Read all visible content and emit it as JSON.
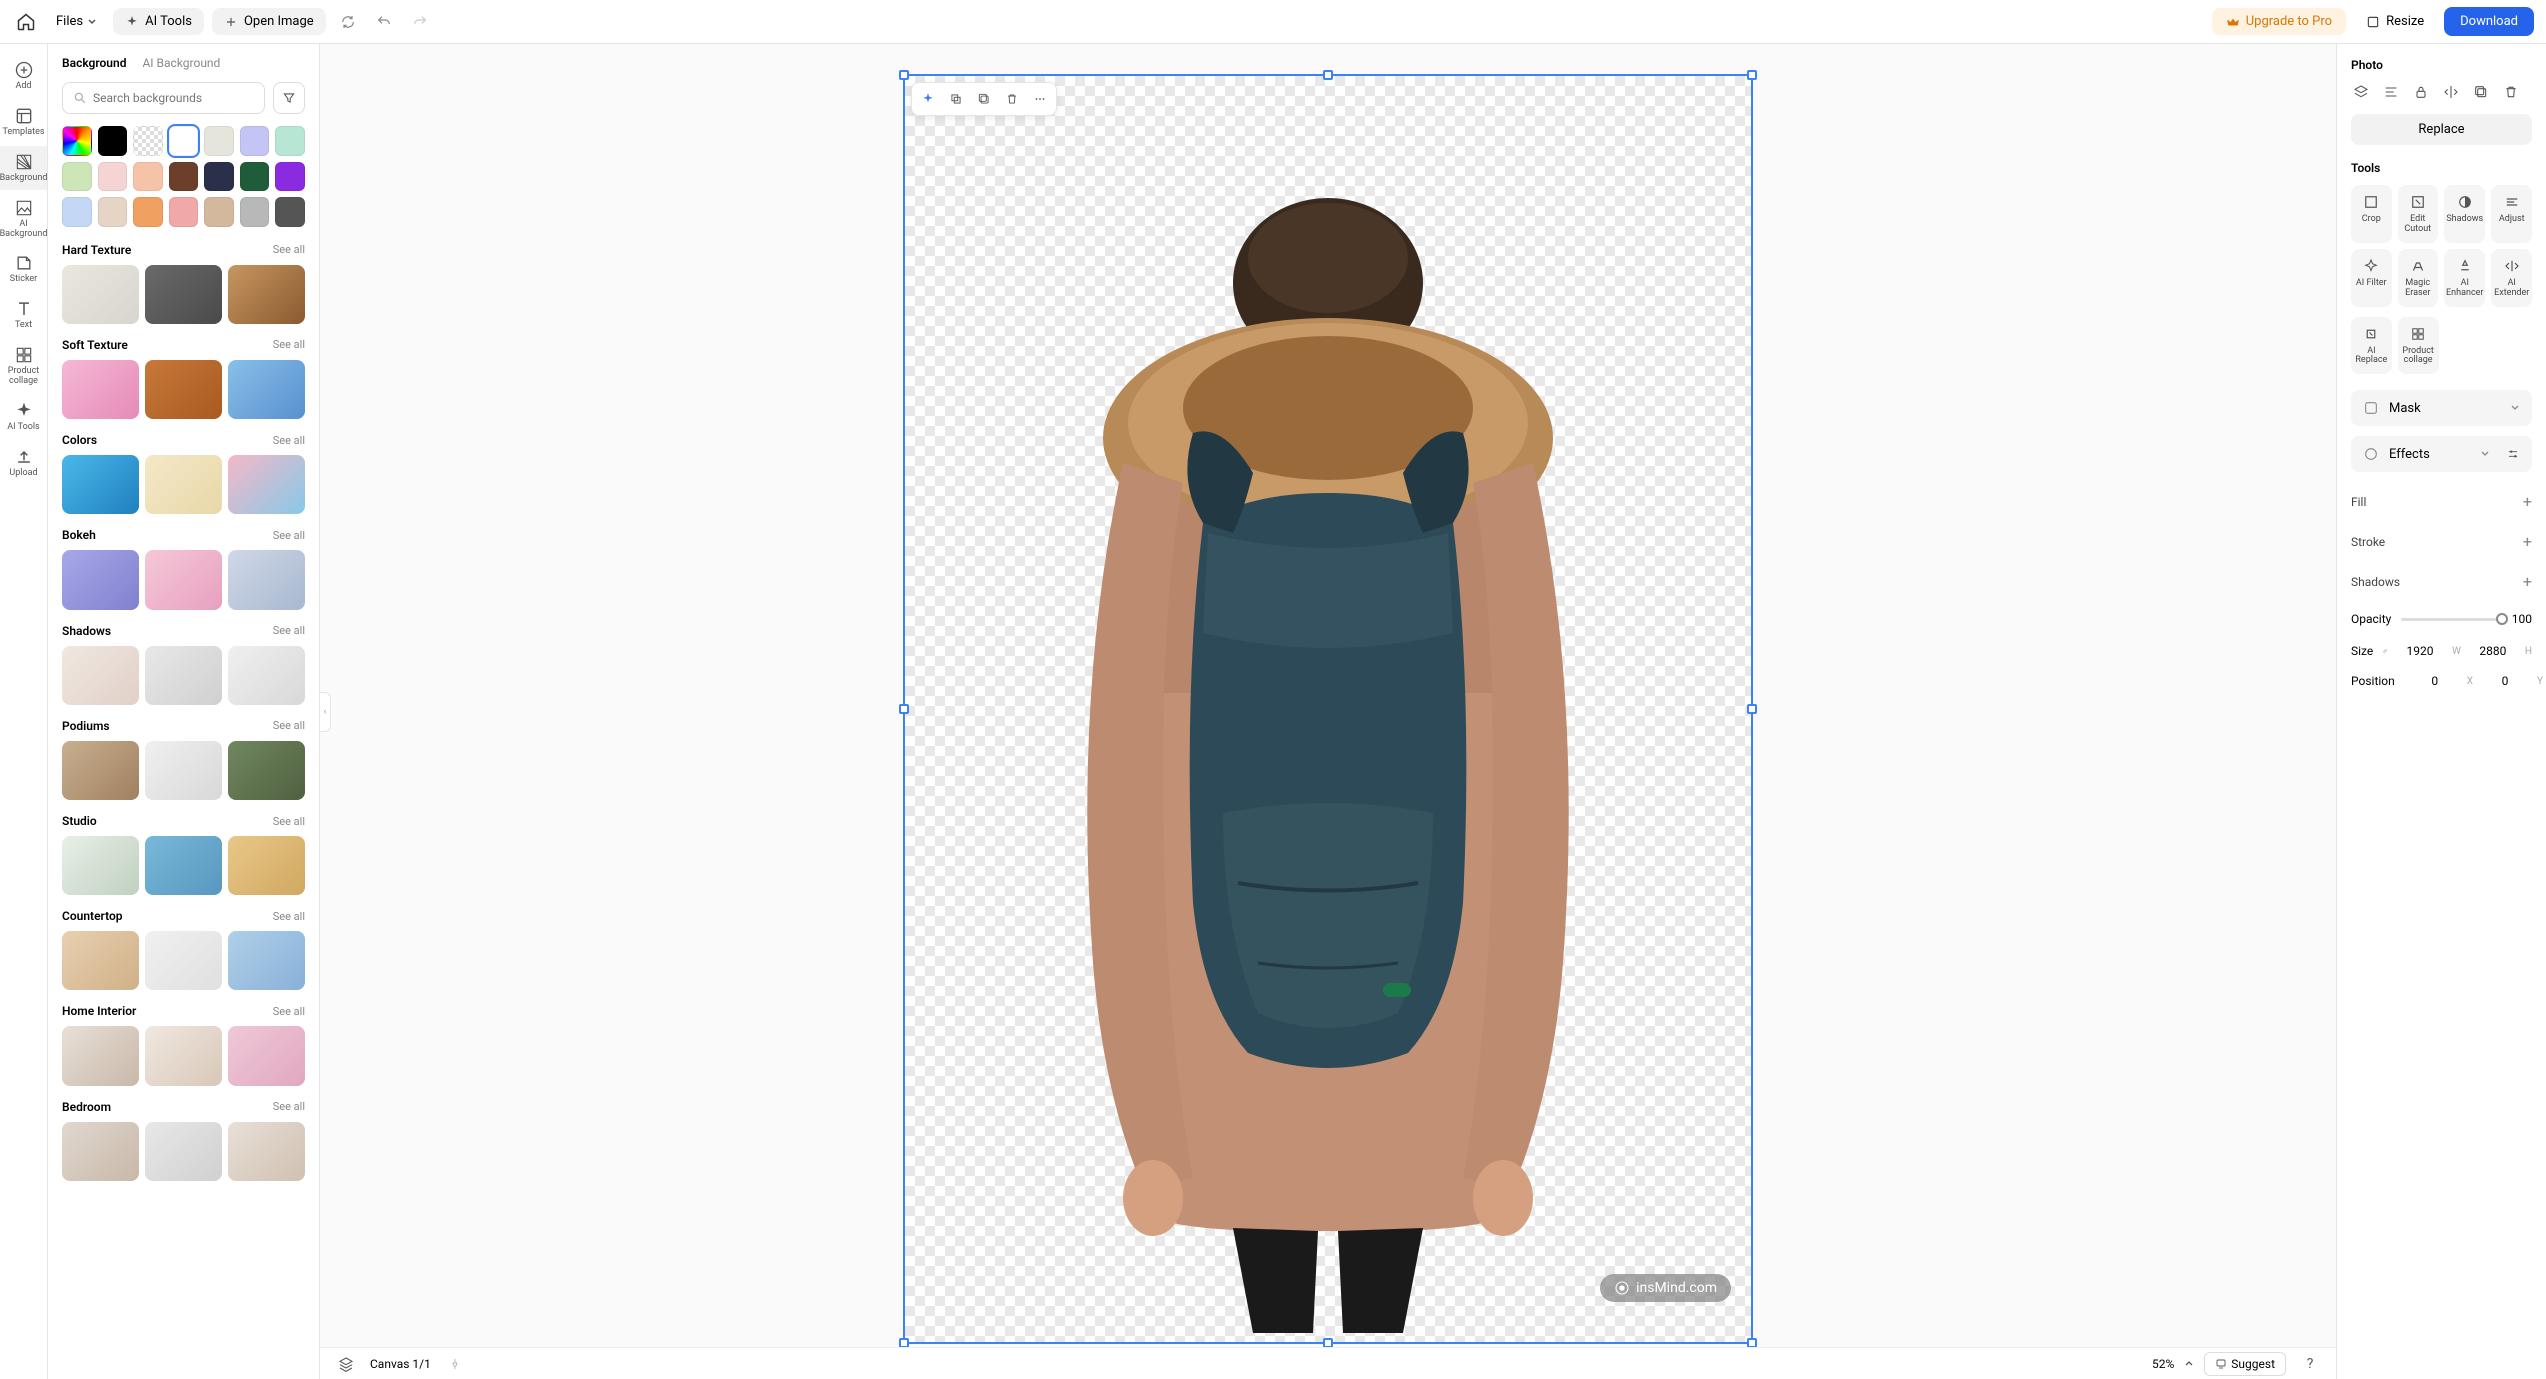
{
  "topbar": {
    "files": "Files",
    "ai_tools": "AI Tools",
    "open_image": "Open Image",
    "upgrade": "Upgrade to Pro",
    "resize": "Resize",
    "download": "Download"
  },
  "vrail": {
    "items": [
      {
        "label": "Add",
        "icon": "plus-circle"
      },
      {
        "label": "Templates",
        "icon": "template"
      },
      {
        "label": "Background",
        "icon": "background",
        "active": true
      },
      {
        "label": "AI Background",
        "icon": "ai-bg"
      },
      {
        "label": "Sticker",
        "icon": "sticker"
      },
      {
        "label": "Text",
        "icon": "text"
      },
      {
        "label": "Product collage",
        "icon": "collage"
      },
      {
        "label": "AI Tools",
        "icon": "ai-tools"
      },
      {
        "label": "Upload",
        "icon": "upload"
      }
    ]
  },
  "leftPanel": {
    "tabs": {
      "background": "Background",
      "ai_background": "AI Background"
    },
    "search_placeholder": "Search backgrounds",
    "swatches": [
      "rainbow",
      "#000000",
      "transparent",
      "#ffffff",
      "#e5e5dc",
      "#c4c4f5",
      "#b8e6d4",
      "#cde6b8",
      "#f5d4d4",
      "#f5c4a8",
      "#6b3f2a",
      "#2a2f4a",
      "#1f5c3a",
      "#8a2be2",
      "#c4d8f5",
      "#e6d4c4",
      "#f0a060",
      "#f0a8a8",
      "#d4b89e",
      "#b8b8b8",
      "#555555"
    ],
    "see_all": "See all",
    "sections": [
      {
        "title": "Hard Texture",
        "thumbs": [
          "#eae6e0,#d8d4ce",
          "#6a6a6a,#4a4a4a",
          "#c89660,#8a5a30"
        ]
      },
      {
        "title": "Soft Texture",
        "thumbs": [
          "#f5b8d4,#e68ab8",
          "#c8783a,#a85a20",
          "#88c0e8,#5890d0"
        ]
      },
      {
        "title": "Colors",
        "thumbs": [
          "#4ab8e8,#2080c0",
          "#f5e8c8,#e8d8a8",
          "#f5b8c8,#88c8e8"
        ]
      },
      {
        "title": "Bokeh",
        "thumbs": [
          "#a8a8e8,#8080d0",
          "#f5c8d8,#e8a0c0",
          "#d0d8e8,#a8b8d0"
        ]
      },
      {
        "title": "Shadows",
        "thumbs": [
          "#f0e8e0,#e0d0c8",
          "#e8e8e8,#d0d0d0",
          "#f0f0f0,#d8d8d8"
        ]
      },
      {
        "title": "Podiums",
        "thumbs": [
          "#c8b090,#a08060",
          "#f0f0f0,#d8d8d8",
          "#708860,#506040"
        ]
      },
      {
        "title": "Studio",
        "thumbs": [
          "#e8f0e8,#c0d0c0",
          "#78b8d8,#5898c0",
          "#e8c888,#d0a860"
        ]
      },
      {
        "title": "Countertop",
        "thumbs": [
          "#e8d0b0,#d0b088",
          "#f0f0f0,#e0e0e0",
          "#b0d0e8,#88b0d8"
        ]
      },
      {
        "title": "Home Interior",
        "thumbs": [
          "#e8e0d8,#c8b8a8",
          "#f0e8e0,#d8c8b8",
          "#f0c8d8,#e0a8c0"
        ]
      },
      {
        "title": "Bedroom",
        "thumbs": [
          "#e0d8d0,#c8b8a8",
          "#e8e8e8,#d0d0d0",
          "#e8e0d8,#d0c0b0"
        ]
      }
    ]
  },
  "rightPanel": {
    "title": "Photo",
    "replace": "Replace",
    "tools_label": "Tools",
    "tools": [
      {
        "label": "Crop"
      },
      {
        "label": "Edit Cutout"
      },
      {
        "label": "Shadows"
      },
      {
        "label": "Adjust"
      },
      {
        "label": "AI Filter"
      },
      {
        "label": "Magic Eraser"
      },
      {
        "label": "AI Enhancer"
      },
      {
        "label": "AI Extender"
      },
      {
        "label": "AI Replace"
      },
      {
        "label": "Product collage"
      }
    ],
    "mask": "Mask",
    "effects": "Effects",
    "fill": "Fill",
    "stroke": "Stroke",
    "shadows": "Shadows",
    "opacity_label": "Opacity",
    "opacity_value": "100",
    "size_label": "Size",
    "size_w": "1920",
    "size_h": "2880",
    "position_label": "Position",
    "pos_x": "0",
    "pos_y": "0"
  },
  "canvas": {
    "watermark": "insMind.com"
  },
  "bottombar": {
    "canvas_label": "Canvas 1/1",
    "zoom": "52%",
    "suggest": "Suggest"
  }
}
